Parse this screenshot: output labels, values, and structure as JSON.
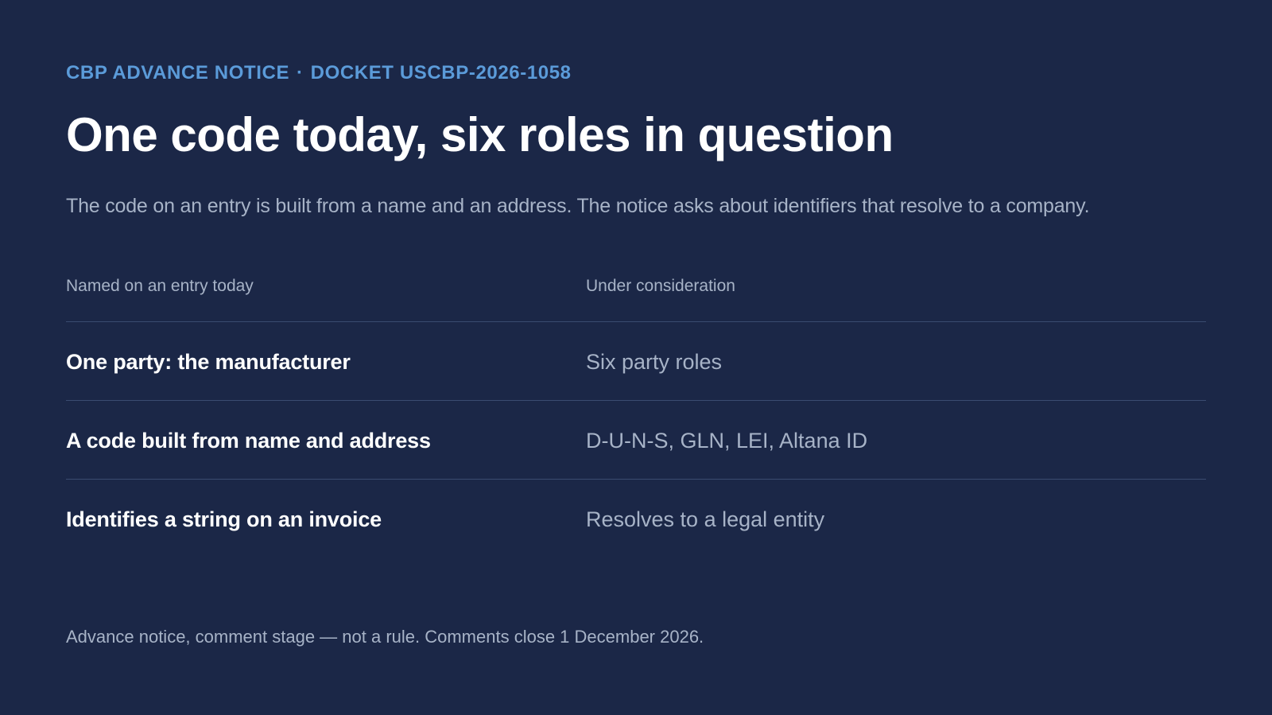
{
  "header": {
    "eyebrow_left": "CBP ADVANCE NOTICE",
    "eyebrow_separator": "·",
    "eyebrow_right": "DOCKET USCBP-2026-1058",
    "title": "One code today, six roles in question",
    "subtitle": "The code on an entry is built from a name and an address. The notice asks about identifiers that resolve to a company."
  },
  "table": {
    "columns": [
      "Named on an entry today",
      "Under consideration"
    ],
    "rows": [
      {
        "today": "One party: the manufacturer",
        "proposed": "Six party roles"
      },
      {
        "today": "A code built from name and address",
        "proposed": "D-U-N-S, GLN, LEI, Altana ID"
      },
      {
        "today": "Identifies a string on an invoice",
        "proposed": "Resolves to a legal entity"
      }
    ]
  },
  "footer": {
    "note": "Advance notice, comment stage — not a rule. Comments close 1 December 2026."
  },
  "colors": {
    "background": "#1b2747",
    "accent": "#5b9bd9",
    "primary_text": "#ffffff",
    "muted_text": "#a7b3c7",
    "divider": "#3a4b70"
  }
}
